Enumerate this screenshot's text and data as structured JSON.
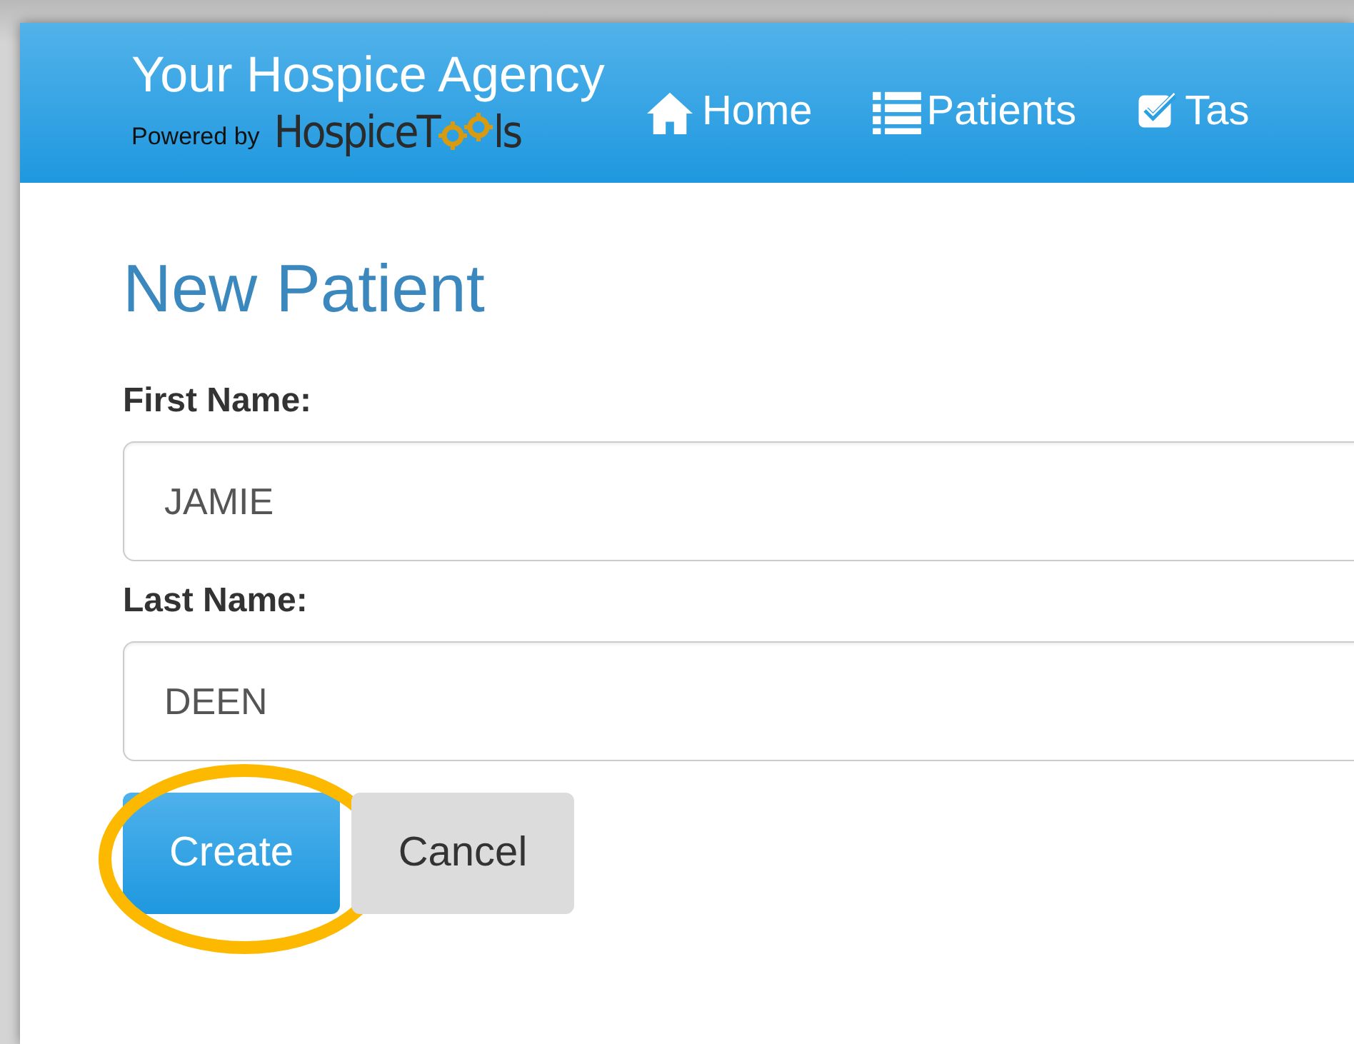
{
  "header": {
    "agency_name": "Your Hospice Agency",
    "powered_by": "Powered by",
    "brand_start": "HospiceT",
    "brand_end": "ls"
  },
  "nav": [
    {
      "kind": "home",
      "label": "Home"
    },
    {
      "kind": "list",
      "label": "Patients"
    },
    {
      "kind": "check",
      "label": "Tas"
    }
  ],
  "page_title": "New Patient",
  "fields": [
    {
      "label": "First Name:",
      "value": "JAMIE"
    },
    {
      "label": "Last Name:",
      "value": "DEEN"
    }
  ],
  "buttons": [
    {
      "kind": "primary",
      "label": "Create",
      "highlighted": true
    },
    {
      "kind": "default",
      "label": "Cancel",
      "highlighted": false
    }
  ]
}
